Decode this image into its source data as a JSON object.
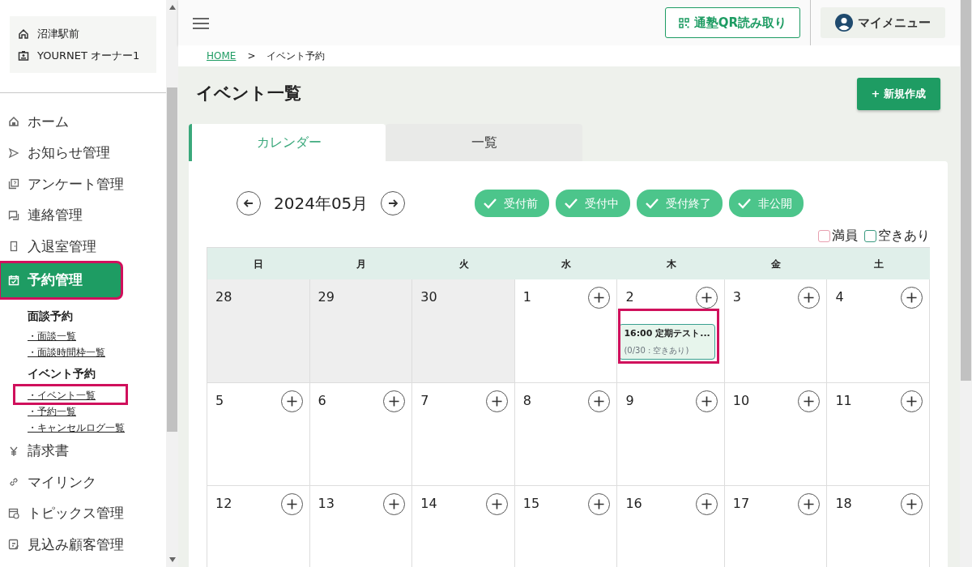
{
  "sidebar": {
    "profile": [
      {
        "kind": "school",
        "text": "沼津駅前"
      },
      {
        "kind": "user",
        "text": "YOURNET オーナー1"
      }
    ],
    "items": [
      {
        "kind": "home",
        "label": "ホーム",
        "selected": false,
        "highlighted": false
      },
      {
        "kind": "send",
        "label": "お知らせ管理",
        "selected": false,
        "highlighted": false
      },
      {
        "kind": "survey",
        "label": "アンケート管理",
        "selected": false,
        "highlighted": false
      },
      {
        "kind": "chat",
        "label": "連絡管理",
        "selected": false,
        "highlighted": false
      },
      {
        "kind": "door",
        "label": "入退室管理",
        "selected": false,
        "highlighted": false
      },
      {
        "kind": "calendar",
        "label": "予約管理",
        "selected": true,
        "highlighted": true,
        "groups": [
          {
            "title": "面談予約",
            "links": [
              {
                "label": "・面談一覧",
                "highlighted": false
              },
              {
                "label": "・面談時間枠一覧",
                "highlighted": false
              }
            ]
          },
          {
            "title": "イベント予約",
            "links": [
              {
                "label": "・イベント一覧",
                "highlighted": true
              },
              {
                "label": "・予約一覧",
                "highlighted": false
              },
              {
                "label": "・キャンセルログ一覧",
                "highlighted": false
              }
            ]
          }
        ]
      },
      {
        "kind": "yen",
        "label": "請求書",
        "selected": false,
        "highlighted": false
      },
      {
        "kind": "link",
        "label": "マイリンク",
        "selected": false,
        "highlighted": false
      },
      {
        "kind": "topics",
        "label": "トピックス管理",
        "selected": false,
        "highlighted": false
      },
      {
        "kind": "prospect",
        "label": "見込み顧客管理",
        "selected": false,
        "highlighted": false
      }
    ]
  },
  "topbar": {
    "qr_button": "通塾QR読み取り",
    "menu_button": "マイメニュー"
  },
  "breadcrumb": [
    {
      "label": "HOME",
      "link": true
    },
    {
      "label": ">",
      "link": false
    },
    {
      "label": "イベント予約",
      "link": false
    }
  ],
  "page_title": "イベント一覧",
  "new_button": "+ 新規作成",
  "tabs": [
    {
      "label": "カレンダー",
      "selected": true
    },
    {
      "label": "一覧",
      "selected": false
    }
  ],
  "calendar": {
    "month": "2024年05月",
    "filters": [
      {
        "label": "受付前",
        "checked": true
      },
      {
        "label": "受付中",
        "checked": true
      },
      {
        "label": "受付終了",
        "checked": true
      },
      {
        "label": "非公開",
        "checked": true
      }
    ],
    "legend": [
      {
        "label": "満員",
        "color": "#e8a0b0"
      },
      {
        "label": "空きあり",
        "color": "#3a9a80"
      }
    ],
    "weekdays": [
      "日",
      "月",
      "火",
      "水",
      "木",
      "金",
      "土"
    ],
    "weeks": [
      [
        {
          "day": "28",
          "outside": true
        },
        {
          "day": "29",
          "outside": true
        },
        {
          "day": "30",
          "outside": true
        },
        {
          "day": "1",
          "outside": false
        },
        {
          "day": "2",
          "outside": false,
          "events": [
            {
              "title": "16:00 定期テスト...",
              "detail": "(0/30 : 空きあり)",
              "full": false,
              "highlighted": true
            }
          ]
        },
        {
          "day": "3",
          "outside": false
        },
        {
          "day": "4",
          "outside": false
        }
      ],
      [
        {
          "day": "5",
          "outside": false
        },
        {
          "day": "6",
          "outside": false
        },
        {
          "day": "7",
          "outside": false
        },
        {
          "day": "8",
          "outside": false
        },
        {
          "day": "9",
          "outside": false
        },
        {
          "day": "10",
          "outside": false
        },
        {
          "day": "11",
          "outside": false
        }
      ],
      [
        {
          "day": "12",
          "outside": false
        },
        {
          "day": "13",
          "outside": false
        },
        {
          "day": "14",
          "outside": false
        },
        {
          "day": "15",
          "outside": false
        },
        {
          "day": "16",
          "outside": false
        },
        {
          "day": "17",
          "outside": false
        },
        {
          "day": "18",
          "outside": false
        }
      ]
    ]
  }
}
